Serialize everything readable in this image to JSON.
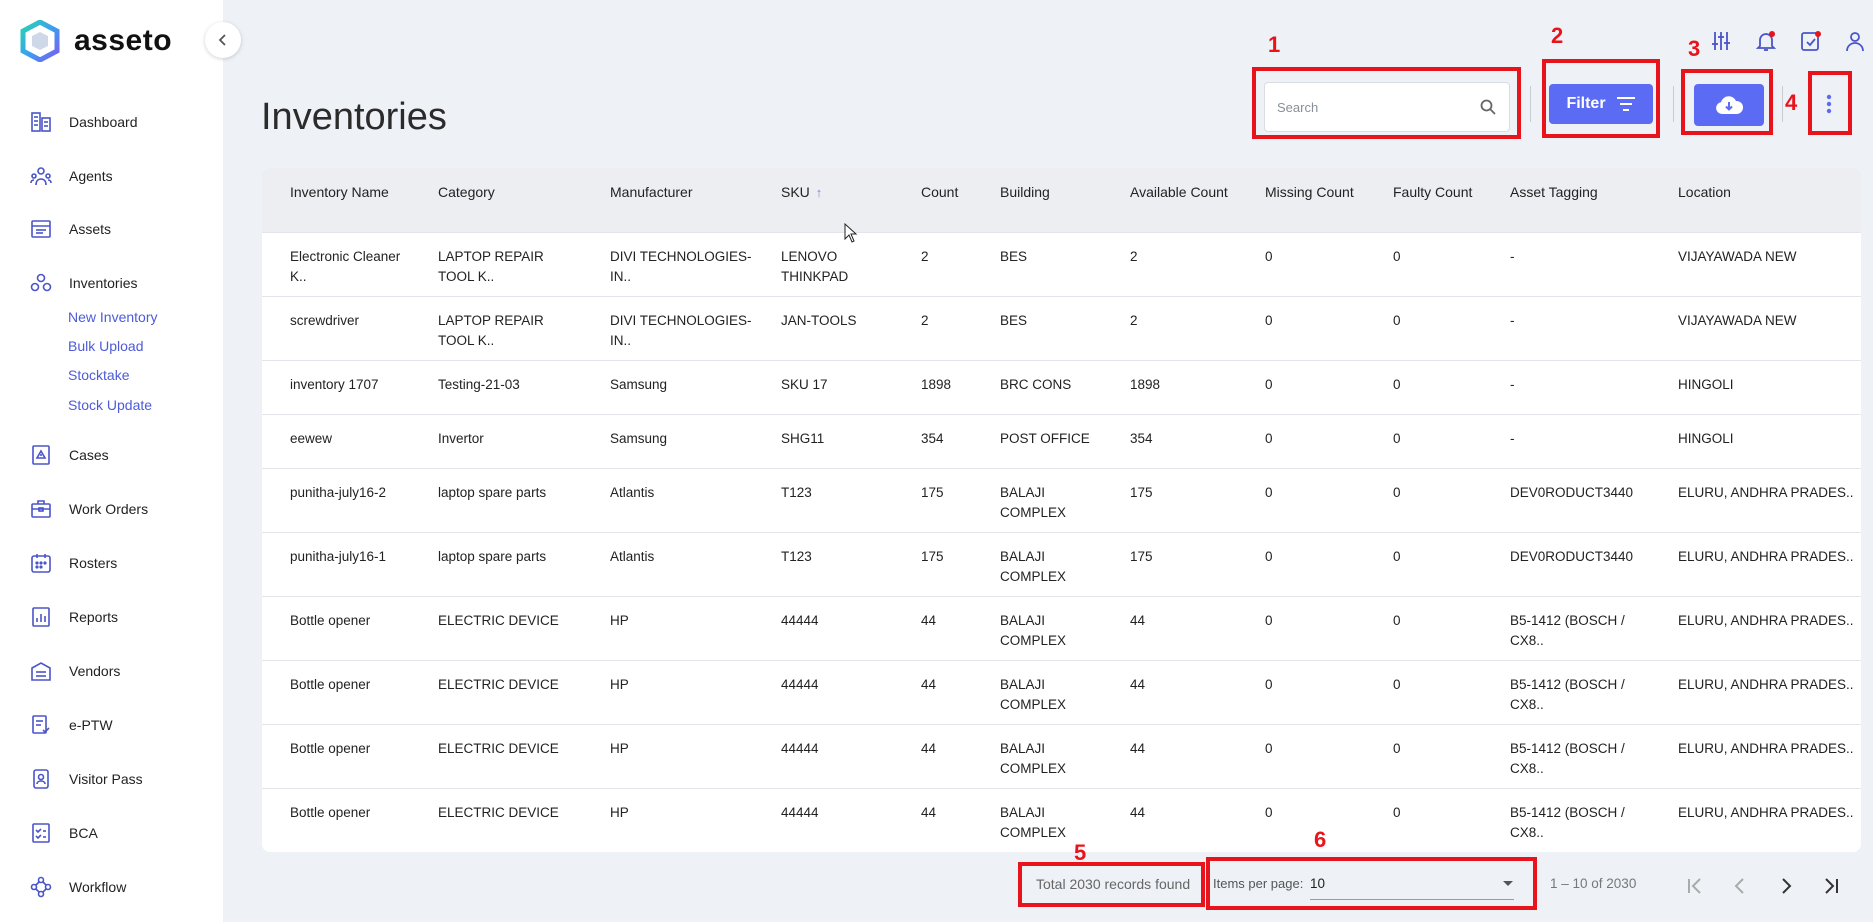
{
  "app": {
    "name": "asseto"
  },
  "sidebar": {
    "items": [
      {
        "label": "Dashboard",
        "icon": "dashboard-icon"
      },
      {
        "label": "Agents",
        "icon": "agents-icon"
      },
      {
        "label": "Assets",
        "icon": "assets-icon"
      },
      {
        "label": "Inventories",
        "icon": "inventories-icon"
      },
      {
        "label": "Cases",
        "icon": "cases-icon"
      },
      {
        "label": "Work Orders",
        "icon": "work-orders-icon"
      },
      {
        "label": "Rosters",
        "icon": "rosters-icon"
      },
      {
        "label": "Reports",
        "icon": "reports-icon"
      },
      {
        "label": "Vendors",
        "icon": "vendors-icon"
      },
      {
        "label": "e-PTW",
        "icon": "eptw-icon"
      },
      {
        "label": "Visitor Pass",
        "icon": "visitor-pass-icon"
      },
      {
        "label": "BCA",
        "icon": "bca-icon"
      },
      {
        "label": "Workflow",
        "icon": "workflow-icon"
      }
    ],
    "inventory_subitems": [
      "New Inventory",
      "Bulk Upload",
      "Stocktake",
      "Stock Update"
    ]
  },
  "page": {
    "title": "Inventories"
  },
  "search": {
    "placeholder": "Search"
  },
  "toolbar": {
    "filter_label": "Filter"
  },
  "annotations": [
    "1",
    "2",
    "3",
    "4",
    "5",
    "6"
  ],
  "table": {
    "columns": [
      "Inventory Name",
      "Category",
      "Manufacturer",
      "SKU",
      "Count",
      "Building",
      "Available Count",
      "Missing Count",
      "Faulty Count",
      "Asset Tagging",
      "Location"
    ],
    "rows": [
      [
        "Electronic Cleaner K..",
        "LAPTOP REPAIR TOOL K..",
        "DIVI TECHNOLOGIES-IN..",
        "LENOVO THINKPAD",
        "2",
        "BES",
        "2",
        "0",
        "0",
        "-",
        "VIJAYAWADA NEW"
      ],
      [
        "screwdriver",
        "LAPTOP REPAIR TOOL K..",
        "DIVI TECHNOLOGIES-IN..",
        "JAN-TOOLS",
        "2",
        "BES",
        "2",
        "0",
        "0",
        "-",
        "VIJAYAWADA NEW"
      ],
      [
        "inventory 1707",
        "Testing-21-03",
        "Samsung",
        "SKU 17",
        "1898",
        "BRC CONS",
        "1898",
        "0",
        "0",
        "-",
        "HINGOLI"
      ],
      [
        "eewew",
        "Invertor",
        "Samsung",
        "SHG11",
        "354",
        "POST OFFICE",
        "354",
        "0",
        "0",
        "-",
        "HINGOLI"
      ],
      [
        "punitha-july16-2",
        "laptop spare parts",
        "Atlantis",
        "T123",
        "175",
        "BALAJI COMPLEX",
        "175",
        "0",
        "0",
        "DEV0RODUCT3440",
        "ELURU, ANDHRA PRADES.."
      ],
      [
        "punitha-july16-1",
        "laptop spare parts",
        "Atlantis",
        "T123",
        "175",
        "BALAJI COMPLEX",
        "175",
        "0",
        "0",
        "DEV0RODUCT3440",
        "ELURU, ANDHRA PRADES.."
      ],
      [
        "Bottle opener",
        "ELECTRIC DEVICE",
        "HP",
        "44444",
        "44",
        "BALAJI COMPLEX",
        "44",
        "0",
        "0",
        "B5-1412 (BOSCH / CX8..",
        "ELURU, ANDHRA PRADES.."
      ],
      [
        "Bottle opener",
        "ELECTRIC DEVICE",
        "HP",
        "44444",
        "44",
        "BALAJI COMPLEX",
        "44",
        "0",
        "0",
        "B5-1412 (BOSCH / CX8..",
        "ELURU, ANDHRA PRADES.."
      ],
      [
        "Bottle opener",
        "ELECTRIC DEVICE",
        "HP",
        "44444",
        "44",
        "BALAJI COMPLEX",
        "44",
        "0",
        "0",
        "B5-1412 (BOSCH / CX8..",
        "ELURU, ANDHRA PRADES.."
      ],
      [
        "Bottle opener",
        "ELECTRIC DEVICE",
        "HP",
        "44444",
        "44",
        "BALAJI COMPLEX",
        "44",
        "0",
        "0",
        "B5-1412 (BOSCH / CX8..",
        "ELURU, ANDHRA PRADES.."
      ]
    ]
  },
  "footer": {
    "total": "Total 2030 records found",
    "items_per_page_label": "Items per page:",
    "items_per_page_value": "10",
    "range": "1 – 10 of 2030"
  },
  "colors": {
    "accent": "#5c6bf3",
    "annotation": "#e8141c",
    "sublink": "#4d5bd8"
  }
}
